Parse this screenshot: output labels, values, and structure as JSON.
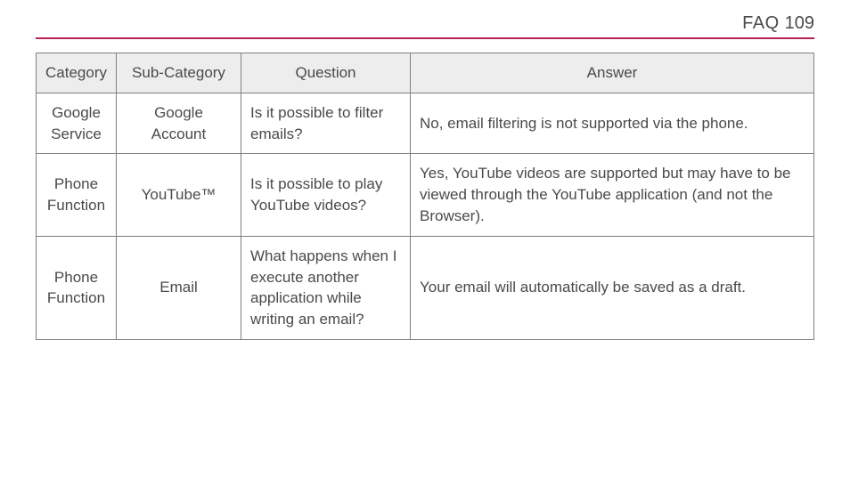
{
  "header": {
    "title": "FAQ",
    "page": "109"
  },
  "table": {
    "headers": {
      "col1": "Category",
      "col2": "Sub-Category",
      "col3": "Question",
      "col4": "Answer"
    },
    "rows": [
      {
        "category": "Google Service",
        "sub": "Google Account",
        "question": "Is it possible to filter emails?",
        "answer": "No, email filtering is not supported via the phone."
      },
      {
        "category": "Phone Function",
        "sub": "YouTube™",
        "question": "Is it possible to play YouTube videos?",
        "answer": "Yes, YouTube videos are supported but may have to be viewed through the YouTube application (and not the Browser)."
      },
      {
        "category": "Phone Function",
        "sub": "Email",
        "question": "What happens when I execute another application while writing an email?",
        "answer": "Your email will automatically be saved as a draft."
      }
    ]
  }
}
